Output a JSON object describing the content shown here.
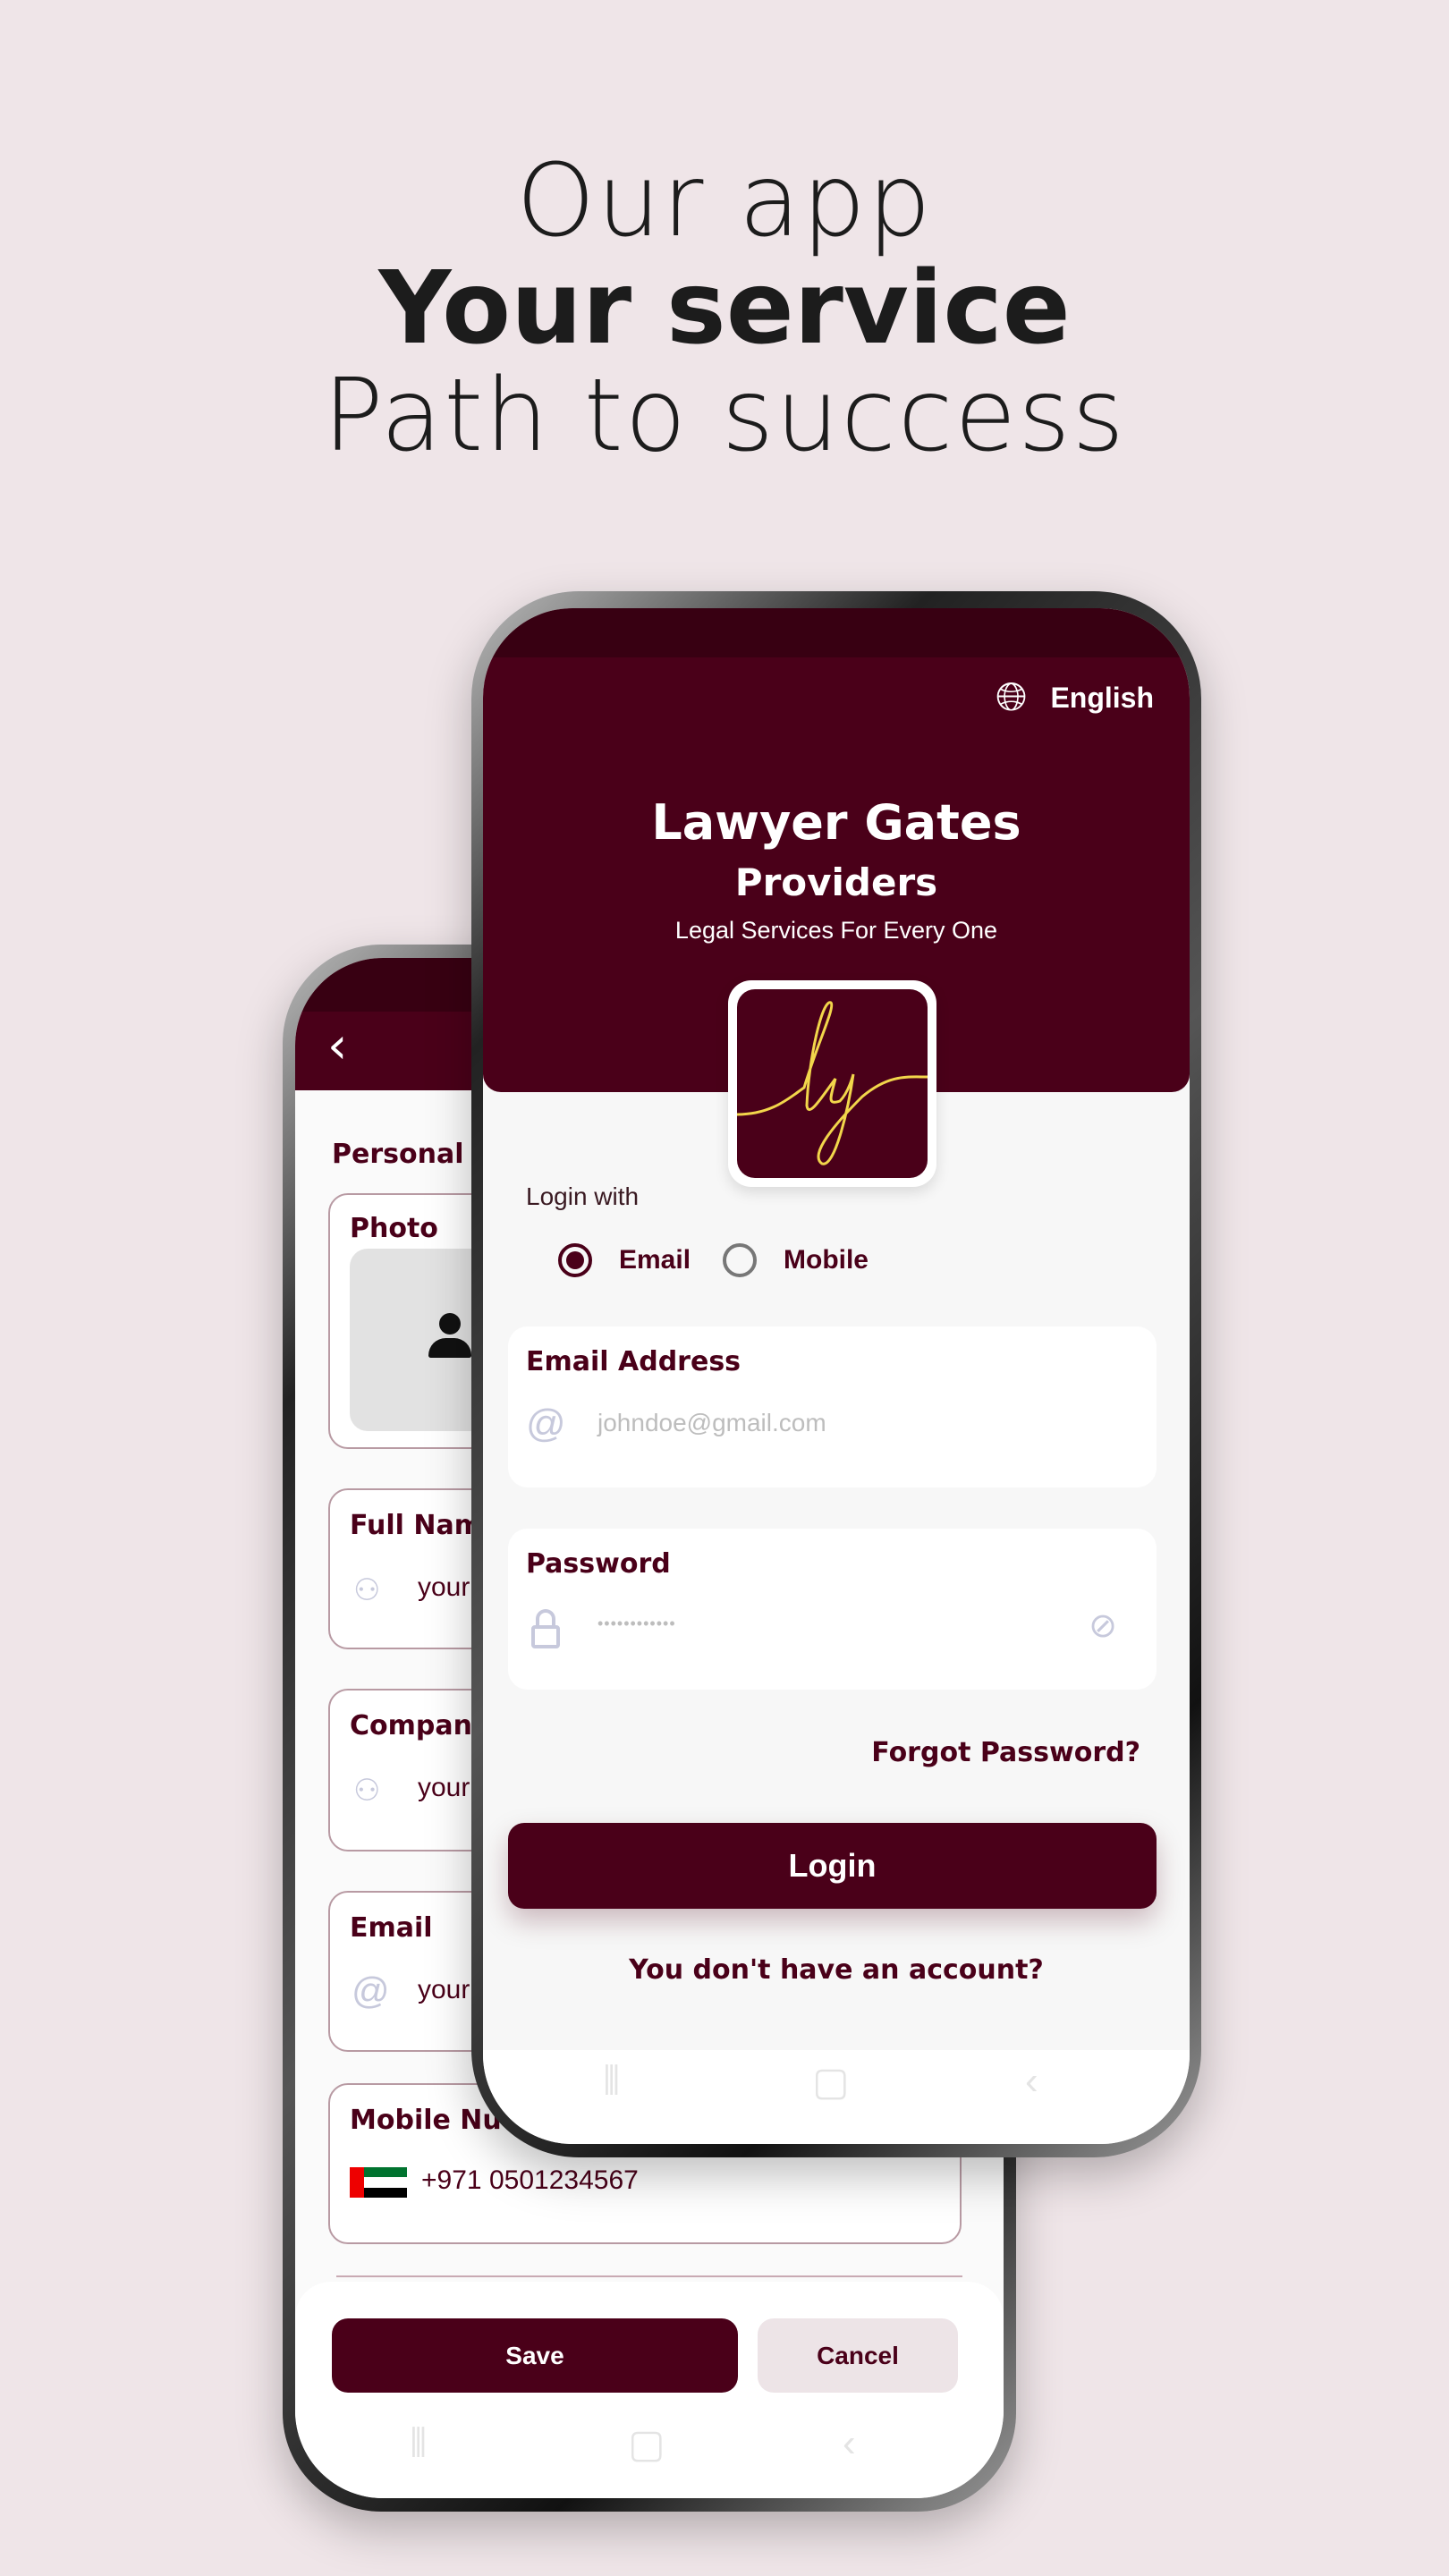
{
  "headline": {
    "line1": "Our app",
    "line2": "Your service",
    "line3": "Path to success"
  },
  "colors": {
    "primary": "#4a0019",
    "status_bar": "#380012",
    "background": "#efe5e8",
    "logo_gold": "#f2d64b"
  },
  "back_phone": {
    "back_icon": "chevron-left-icon",
    "section_title": "Personal I",
    "photo_label": "Photo",
    "fields": [
      {
        "label": "Full Nam",
        "placeholder": "your",
        "icon": "person-icon"
      },
      {
        "label": "Compan",
        "placeholder": "your",
        "icon": "person-icon"
      },
      {
        "label": "Email",
        "placeholder": "your",
        "icon": "at-icon"
      }
    ],
    "mobile": {
      "label": "Mobile Nu",
      "country_code": "+971",
      "number": "0501234567",
      "flag": "uae-flag-icon"
    },
    "save_label": "Save",
    "cancel_label": "Cancel"
  },
  "front_phone": {
    "language": "English",
    "app_title": "Lawyer Gates",
    "app_subtitle": "Providers",
    "tagline": "Legal Services For Every One",
    "logo_text": "lg",
    "login_with": "Login with",
    "options": [
      {
        "label": "Email",
        "selected": true
      },
      {
        "label": "Mobile",
        "selected": false
      }
    ],
    "email_label": "Email Address",
    "email_placeholder": "johndoe@gmail.com",
    "password_label": "Password",
    "password_value": "••••••••••••",
    "forgot": "Forgot Password?",
    "login_label": "Login",
    "signup": "You don't have an account?"
  }
}
